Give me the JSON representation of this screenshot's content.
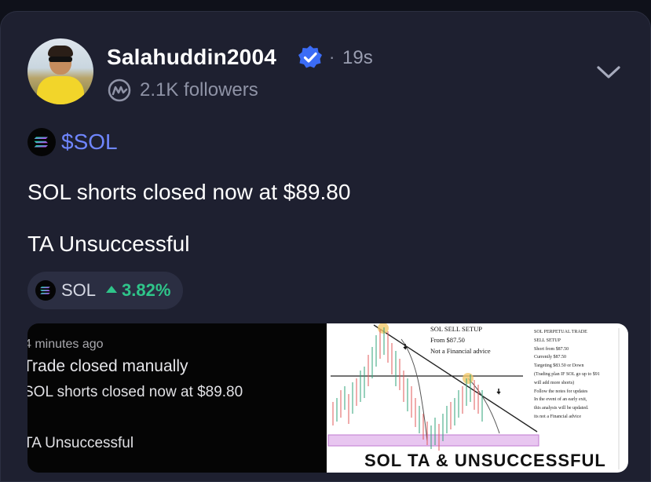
{
  "post": {
    "author": {
      "username": "Salahuddin2004",
      "verified": true,
      "followers": "2.1K followers",
      "avatar_icon": "avatar-photo"
    },
    "separator": "·",
    "time": "19s",
    "tag": {
      "label": "$SOL",
      "icon": "solana-logo-icon"
    },
    "text_lines": [
      "SOL shorts closed now at $89.80",
      "TA Unsuccessful"
    ],
    "chip": {
      "symbol": "SOL",
      "change": "3.82%",
      "direction": "up",
      "icon": "solana-logo-icon"
    },
    "media": {
      "left": {
        "time": "4 minutes ago",
        "title": "Trade closed manually",
        "body": "SOL shorts closed now at $89.80",
        "ta": "TA Unsuccessful"
      },
      "right": {
        "setup_lines": [
          "SOL SELL SETUP",
          "From $87.50",
          "Not a Financial advice"
        ],
        "notes": [
          "SOL PERPETUAL TRADE",
          "SELL SETUP",
          "Short from $87.50",
          "Currently $87.50",
          "Targeting $83.50 or Down",
          "(Trading plan IF SOL go up to $91",
          "will add more shorts)",
          "Follow the notes for updates",
          "In the event of an early exit,",
          "this analysis will be updated.",
          "its not a Financial advice"
        ],
        "bottom_title": "SOL TA & UNSUCCESSFUL"
      }
    }
  },
  "colors": {
    "background": "#0f111a",
    "card": "#1e2030",
    "accent_link": "#6f86ff",
    "positive": "#2fc58a",
    "verified": "#3b6cf6",
    "muted": "#8f93a6"
  },
  "icons": {
    "verified": "verified-badge-icon",
    "community": "coinmarketcap-icon",
    "expand": "chevron-down-icon"
  }
}
